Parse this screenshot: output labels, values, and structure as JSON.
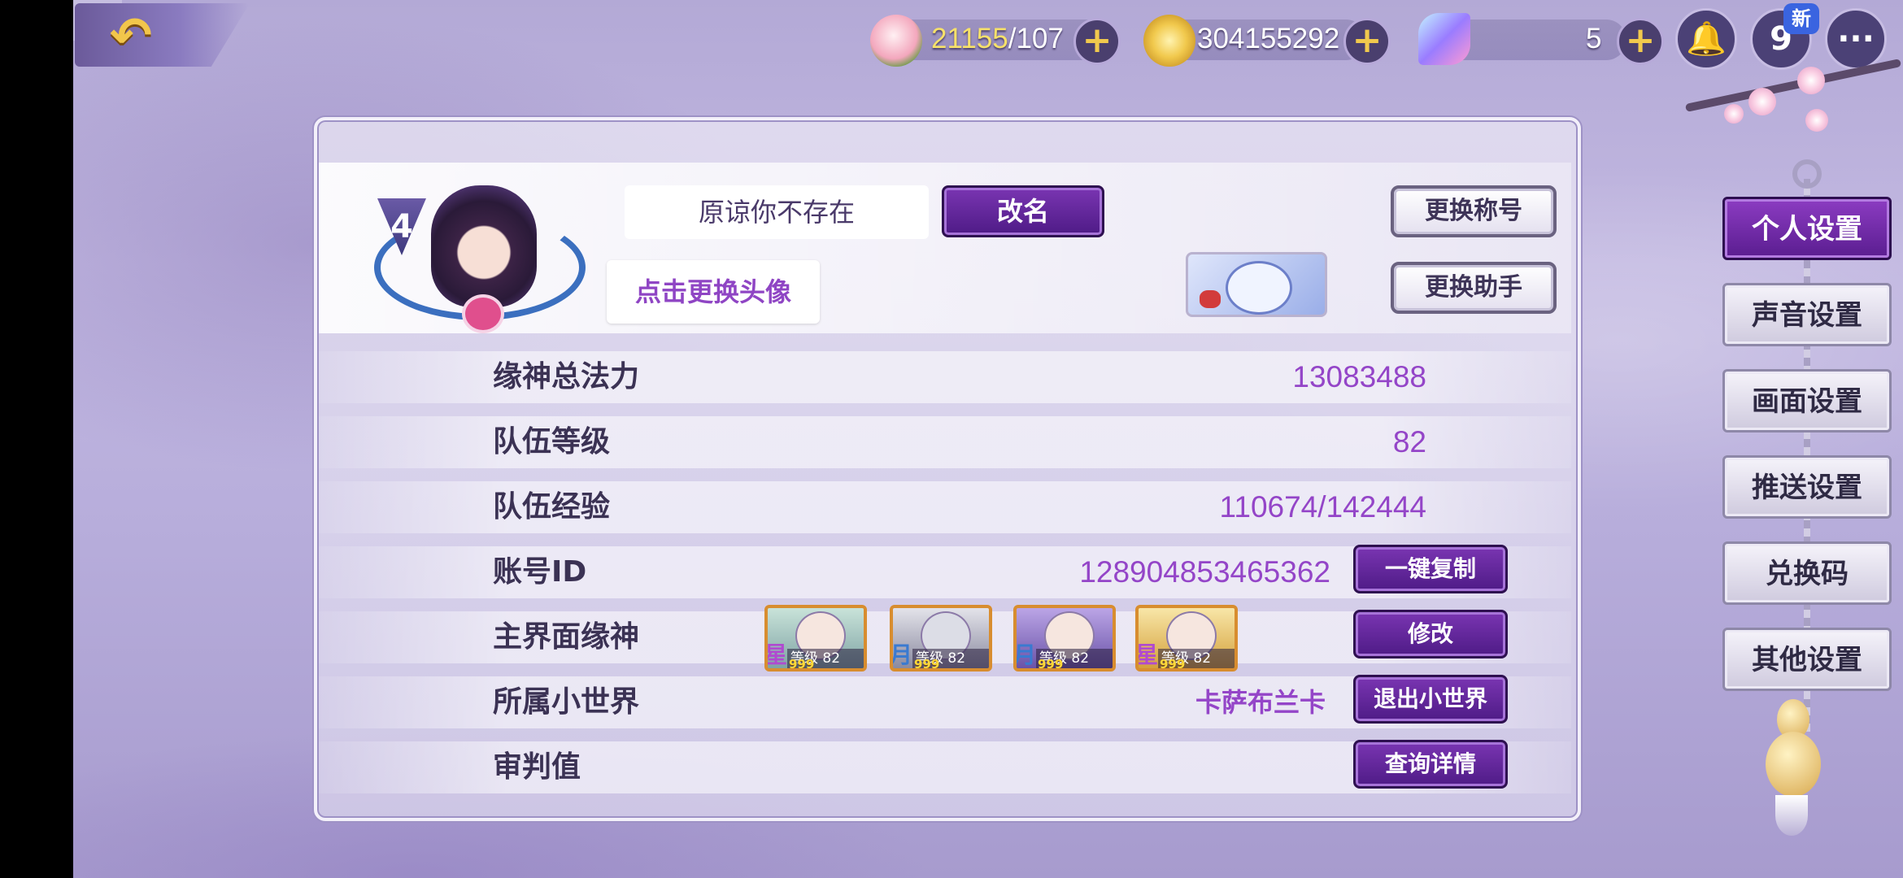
{
  "resources": {
    "peach": {
      "current": "21155",
      "max": "/107",
      "icon": "peach-icon"
    },
    "coin": {
      "value": "304155292",
      "icon": "gold-coin-icon"
    },
    "crystal": {
      "value": "5",
      "icon": "crystal-icon"
    },
    "plus": "+"
  },
  "top_buttons": {
    "back_glyph": "↶",
    "notify_glyph": "🔔",
    "nine_glyph": "9",
    "new_badge": "新",
    "chat_glyph": "···"
  },
  "profile": {
    "avatar_level": "4",
    "player_name": "原谅你不存在",
    "rename_label": "改名",
    "change_avatar_label": "点击更换头像",
    "change_title_label": "更换称号",
    "change_assistant_label": "更换助手"
  },
  "stats": {
    "rows": [
      {
        "label": "缘神总法力",
        "value": "13083488"
      },
      {
        "label": "队伍等级",
        "value": "82"
      },
      {
        "label": "队伍经验",
        "value": "110674/142444"
      },
      {
        "label": "账号ID",
        "value": "128904853465362",
        "button": "一键复制"
      },
      {
        "label": "主界面缘神",
        "value": "",
        "button": "修改"
      },
      {
        "label": "所属小世界",
        "value": "卡萨布兰卡",
        "button": "退出小世界"
      },
      {
        "label": "审判值",
        "value": "",
        "button": "查询详情"
      }
    ]
  },
  "heroes": [
    {
      "level": "等级 82",
      "stars": "999",
      "badge": "星"
    },
    {
      "level": "等级 82",
      "stars": "999",
      "badge": "月"
    },
    {
      "level": "等级 82",
      "stars": "999",
      "badge": "月"
    },
    {
      "level": "等级 82",
      "stars": "999",
      "badge": "星"
    }
  ],
  "menu": [
    {
      "label": "个人设置",
      "active": true
    },
    {
      "label": "声音设置",
      "active": false
    },
    {
      "label": "画面设置",
      "active": false
    },
    {
      "label": "推送设置",
      "active": false
    },
    {
      "label": "兑换码",
      "active": false
    },
    {
      "label": "其他设置",
      "active": false
    }
  ],
  "colors": {
    "accent_purple": "#7a35b2",
    "value_purple": "#9445c8",
    "gold": "#f1c94d"
  }
}
